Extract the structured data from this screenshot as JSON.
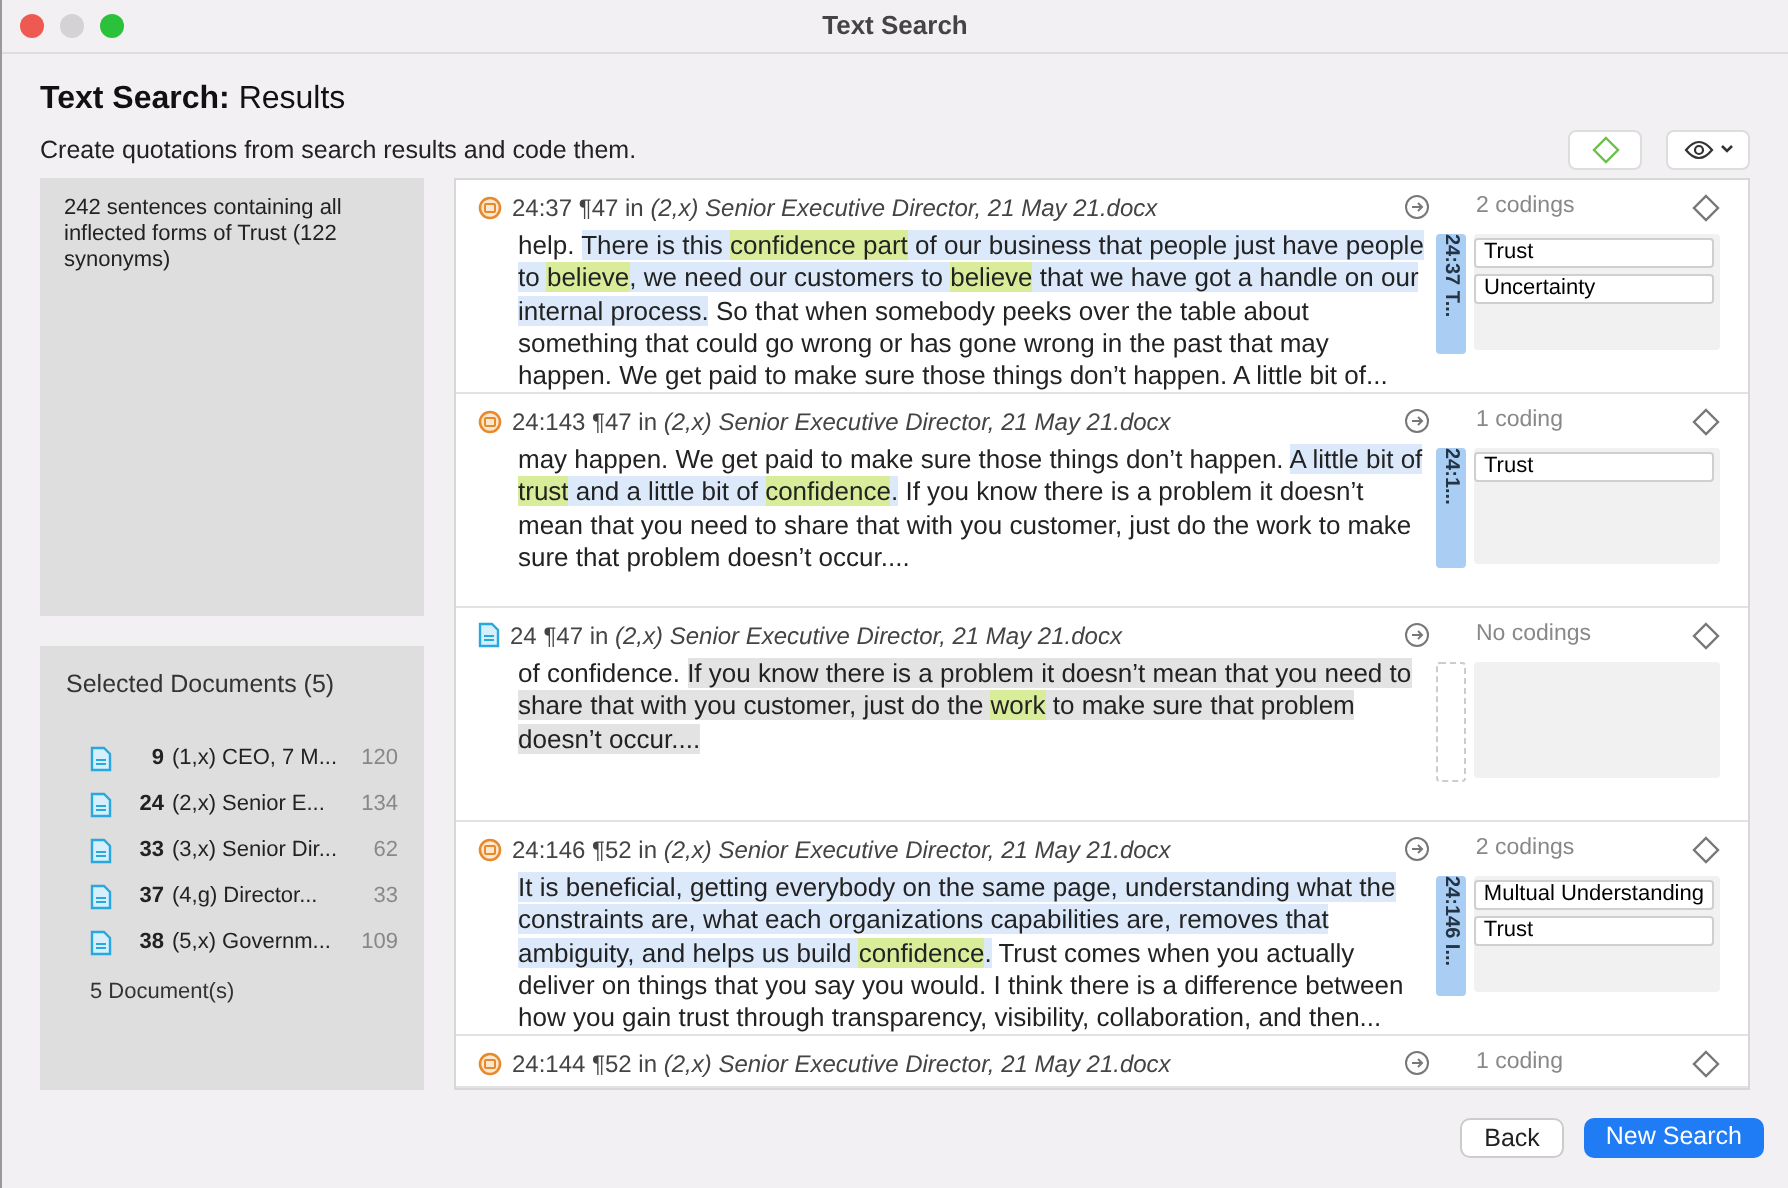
{
  "window": {
    "title": "Text Search"
  },
  "header": {
    "title_bold": "Text Search:",
    "title_rest": "Results",
    "subtitle": "Create quotations from search results and code them."
  },
  "summary": "242 sentences containing all inflected forms of Trust (122 synonyms)",
  "documents": {
    "title": "Selected Documents (5)",
    "items": [
      {
        "number": "9",
        "name": "(1,x) CEO, 7 M...",
        "count": "120"
      },
      {
        "number": "24",
        "name": "(2,x) Senior E...",
        "count": "134"
      },
      {
        "number": "33",
        "name": "(3,x) Senior Dir...",
        "count": "62"
      },
      {
        "number": "37",
        "name": "(4,g) Director...",
        "count": "33"
      },
      {
        "number": "38",
        "name": "(5,x) Governm...",
        "count": "109"
      }
    ],
    "footer": "5 Document(s)"
  },
  "results": [
    {
      "kind": "quotation",
      "id": "24:37",
      "para": "¶47 in",
      "source": "(2,x) Senior Executive Director, 21 May 21.docx",
      "codings_label": "2 codings",
      "tab_label": "24:37 T...",
      "codes": [
        "Trust",
        "Uncertainty"
      ],
      "segments": [
        {
          "text": "help. ",
          "quoted": false,
          "hit": false
        },
        {
          "text": "There is this ",
          "quoted": true,
          "hit": false
        },
        {
          "text": "confidence",
          "hit": true
        },
        {
          "text": " part",
          "hit": true
        },
        {
          "text": " of our business that people just have people to ",
          "quoted": true,
          "hit": false
        },
        {
          "text": "believe",
          "hit": true
        },
        {
          "text": ", we need our customers to ",
          "quoted": true,
          "hit": false
        },
        {
          "text": "believe",
          "hit": true
        },
        {
          "text": " that we have got a handle on our internal process.",
          "quoted": true,
          "hit": false
        },
        {
          "text": " So that when somebody peeks over the table about something that could go wrong or has gone wrong in the past that may happen. We get paid to make sure those things don’t happen. A little bit of...",
          "quoted": false,
          "hit": false
        }
      ]
    },
    {
      "kind": "quotation",
      "id": "24:143",
      "para": "¶47 in",
      "source": "(2,x) Senior Executive Director, 21 May 21.docx",
      "codings_label": "1 coding",
      "tab_label": "24:1...",
      "codes": [
        "Trust"
      ],
      "segments": [
        {
          "text": "may happen. We get paid to make sure those things don’t happen. ",
          "quoted": false,
          "hit": false
        },
        {
          "text": "A little bit of ",
          "quoted": true,
          "hit": false
        },
        {
          "text": "trust",
          "hit": true
        },
        {
          "text": " and a little bit of ",
          "quoted": true,
          "hit": false
        },
        {
          "text": "confidence",
          "hit": true
        },
        {
          "text": ".",
          "quoted": true,
          "hit": false
        },
        {
          "text": " If you know there is a problem it doesn’t mean that you need to share that with you customer, just do the work to make sure that problem doesn’t occur....",
          "quoted": false,
          "hit": false
        }
      ]
    },
    {
      "kind": "document",
      "id": "24",
      "para": "¶47 in",
      "source": "(2,x) Senior Executive Director, 21 May 21.docx",
      "codings_label": "No codings",
      "segments": [
        {
          "text": "of confidence. ",
          "quoted": false,
          "hit": false
        },
        {
          "text": "If you know there is a problem it doesn’t mean that you need to share that with you customer, just do the ",
          "quoted": true,
          "hit": false
        },
        {
          "text": "work",
          "hit": true
        },
        {
          "text": " to make sure that problem doesn’t occur....",
          "quoted": true,
          "hit": false
        }
      ]
    },
    {
      "kind": "quotation",
      "id": "24:146",
      "para": "¶52 in",
      "source": "(2,x) Senior Executive Director, 21 May 21.docx",
      "codings_label": "2 codings",
      "tab_label": "24:146 I...",
      "codes": [
        "Multual Understanding",
        "Trust"
      ],
      "segments": [
        {
          "text": "It is beneficial, getting everybody on the same page, understanding what the constraints are, what each organizations capabilities are, removes that ambiguity, and helps us build ",
          "quoted": true,
          "hit": false
        },
        {
          "text": "confidence",
          "hit": true
        },
        {
          "text": ".",
          "quoted": true,
          "hit": false
        },
        {
          "text": " Trust comes when you actually deliver on things that you say you would. I think there is a difference between how you gain trust through transparency, visibility, collaboration, and then...",
          "quoted": false,
          "hit": false
        }
      ]
    },
    {
      "kind": "quotation",
      "id": "24:144",
      "para": "¶52 in",
      "source": "(2,x) Senior Executive Director, 21 May 21.docx",
      "codings_label": "1 coding"
    }
  ],
  "buttons": {
    "back": "Back",
    "new_search": "New Search"
  }
}
